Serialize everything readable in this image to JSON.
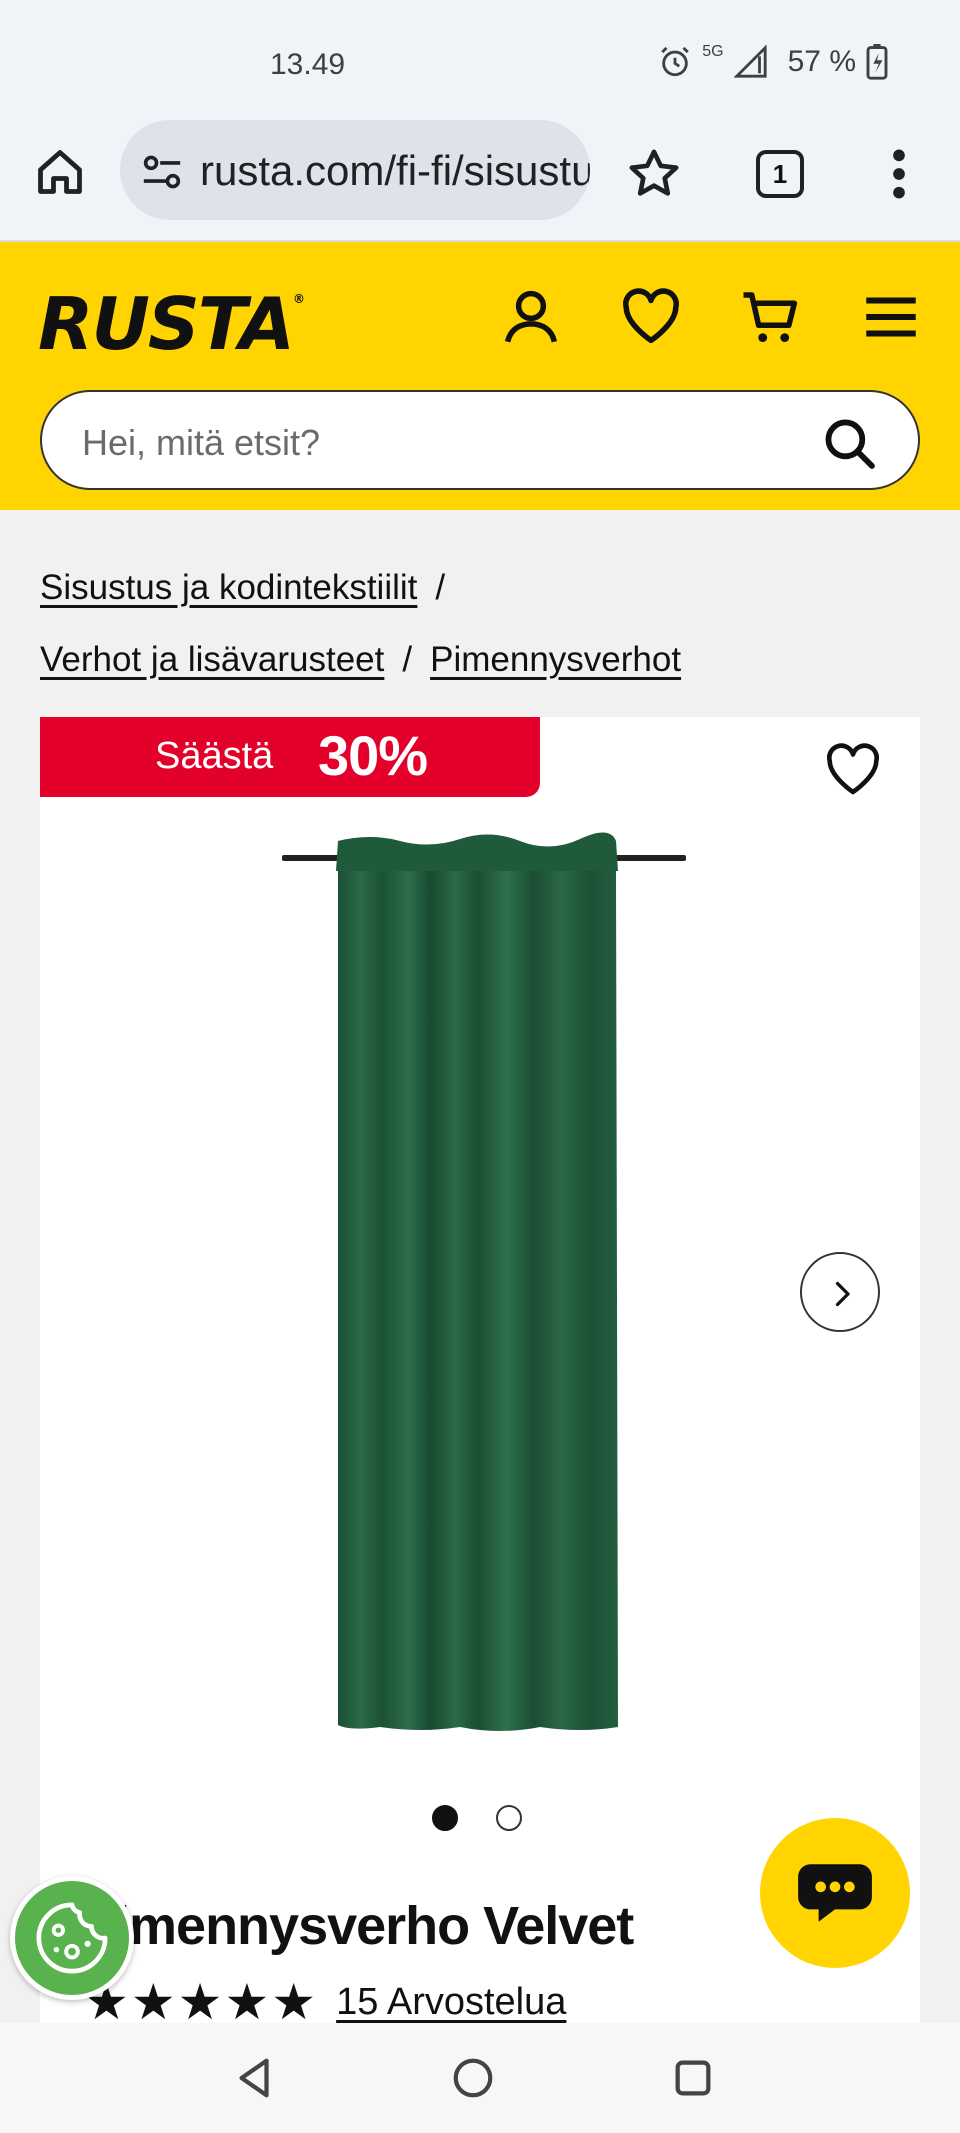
{
  "status_bar": {
    "time": "13.49",
    "network": "5G",
    "battery": "57 %"
  },
  "browser": {
    "url": "rusta.com/fi-fi/sisustus",
    "tab_count": "1"
  },
  "site": {
    "logo": "RUSTA",
    "logo_mark": "®",
    "search_placeholder": "Hei, mitä etsit?"
  },
  "breadcrumb": {
    "items": [
      "Sisustus ja kodintekstiilit",
      "Verhot ja lisävarusteet",
      "Pimennysverhot"
    ],
    "separator": "/"
  },
  "product": {
    "badge_label": "Säästä",
    "badge_percent": "30%",
    "title": "Pimennysverho Velvet",
    "rating_stars": 5,
    "stars_display": "★★★★★",
    "reviews": "15 Arvostelua",
    "image_count": 2,
    "active_image": 1,
    "curtain_color": "#1f5a3a"
  },
  "colors": {
    "brand_yellow": "#ffd400",
    "sale_red": "#e3002b",
    "cookie_green": "#58b24e"
  },
  "icons": [
    "home-icon",
    "site-settings-icon",
    "bookmark-star-icon",
    "tab-switcher-icon",
    "more-vert-icon",
    "account-icon",
    "wishlist-heart-icon",
    "cart-icon",
    "hamburger-menu-icon",
    "search-icon",
    "favorite-heart-icon",
    "chevron-right-icon",
    "chat-icon",
    "cookie-icon",
    "back-nav-icon",
    "home-nav-icon",
    "recents-nav-icon"
  ]
}
